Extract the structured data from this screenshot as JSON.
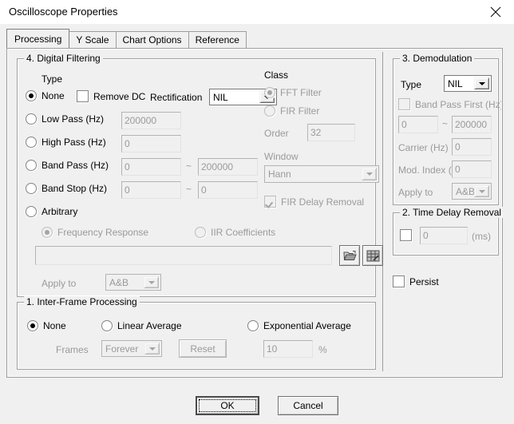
{
  "window": {
    "title": "Oscilloscope Properties",
    "close_icon": "close-icon"
  },
  "tabs": [
    {
      "label": "Processing",
      "active": true
    },
    {
      "label": "Y Scale",
      "active": false
    },
    {
      "label": "Chart Options",
      "active": false
    },
    {
      "label": "Reference",
      "active": false
    }
  ],
  "digital_filtering": {
    "legend": "4. Digital Filtering",
    "type_label": "Type",
    "options": [
      {
        "label": "None",
        "selected": true
      },
      {
        "label": "Low Pass (Hz)",
        "selected": false
      },
      {
        "label": "High Pass (Hz)",
        "selected": false
      },
      {
        "label": "Band Pass (Hz)",
        "selected": false
      },
      {
        "label": "Band Stop (Hz)",
        "selected": false
      },
      {
        "label": "Arbitrary",
        "selected": false
      }
    ],
    "remove_dc": {
      "label": "Remove DC",
      "checked": false
    },
    "rectification": {
      "label": "Rectification",
      "value": "NIL"
    },
    "low_pass_value": "200000",
    "high_pass_value": "0",
    "band_pass_low": "0",
    "band_pass_high": "200000",
    "band_stop_low": "0",
    "band_stop_high": "0",
    "tilde": "~",
    "arbitrary": {
      "frequency_response": {
        "label": "Frequency Response",
        "selected": true
      },
      "iir_coefficients": {
        "label": "IIR Coefficients",
        "selected": false
      },
      "path_value": "",
      "browse_icon": "folder-open-icon",
      "table_icon": "grid-table-icon",
      "apply_to_label": "Apply to",
      "apply_to_value": "A&B"
    }
  },
  "filter_class": {
    "label": "Class",
    "fft_filter": {
      "label": "FFT Filter",
      "selected": true
    },
    "fir_filter": {
      "label": "FIR Filter",
      "selected": false
    },
    "order_label": "Order",
    "order_value": "32",
    "window_label": "Window",
    "window_value": "Hann",
    "fir_delay_removal": {
      "label": "FIR Delay Removal",
      "checked": true
    }
  },
  "demodulation": {
    "legend": "3. Demodulation",
    "type_label": "Type",
    "type_value": "NIL",
    "band_pass_first": {
      "label": "Band Pass First (Hz)",
      "checked": false
    },
    "band_low": "0",
    "band_high": "200000",
    "tilde": "~",
    "carrier_label": "Carrier (Hz)",
    "carrier_value": "0",
    "mod_index_label": "Mod. Index (%)",
    "mod_index_value": "0",
    "apply_to_label": "Apply to",
    "apply_to_value": "A&B"
  },
  "time_delay_removal": {
    "legend": "2. Time Delay Removal",
    "enabled": false,
    "value": "0",
    "unit": "(ms)"
  },
  "persist": {
    "label": "Persist",
    "checked": false
  },
  "inter_frame": {
    "legend": "1. Inter-Frame Processing",
    "none": {
      "label": "None",
      "selected": true
    },
    "linear_average": {
      "label": "Linear Average",
      "selected": false
    },
    "exponential_average": {
      "label": "Exponential Average",
      "selected": false
    },
    "frames_label": "Frames",
    "frames_value": "Forever",
    "reset_label": "Reset",
    "exp_value": "10",
    "percent": "%"
  },
  "footer": {
    "ok_label": "OK",
    "cancel_label": "Cancel"
  }
}
